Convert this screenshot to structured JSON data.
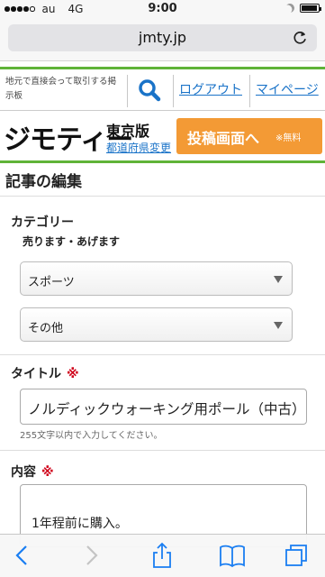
{
  "status_bar": {
    "carrier": "au",
    "network": "4G",
    "time": "9:00",
    "signal_bars": 4,
    "signal_max": 5
  },
  "browser": {
    "url_host": "jmty.jp",
    "reload_icon": "reload-icon"
  },
  "site_nav": {
    "tagline": "地元で直接会って取引する掲示板",
    "search_icon": "search-icon",
    "logout_label": "ログアウト",
    "mypage_label": "マイページ"
  },
  "brand": {
    "logo_text": "ジモティー",
    "region": "東京版",
    "region_change": "都道府県変更",
    "post_button_label": "投稿画面へ",
    "post_button_note": "※無料"
  },
  "form": {
    "page_title": "記事の編集",
    "category": {
      "label": "カテゴリー",
      "selected_group": "売ります・あげます",
      "select1_value": "スポーツ",
      "select2_value": "その他"
    },
    "title_field": {
      "label": "タイトル",
      "required_mark": "※",
      "value": "ノルディックウォーキング用ポール（中古）",
      "hint": "255文字以内で入力してください。"
    },
    "content_field": {
      "label": "内容",
      "required_mark": "※",
      "value": "1年程前に購入。"
    }
  },
  "toolbar": {
    "back_icon": "back-icon",
    "forward_icon": "forward-icon",
    "share_icon": "share-icon",
    "bookmarks_icon": "bookmarks-icon",
    "tabs_icon": "tabs-icon"
  },
  "colors": {
    "accent_green": "#5fb338",
    "link_blue": "#1a73c8",
    "post_orange": "#f39a35",
    "required_red": "#d0021b"
  }
}
